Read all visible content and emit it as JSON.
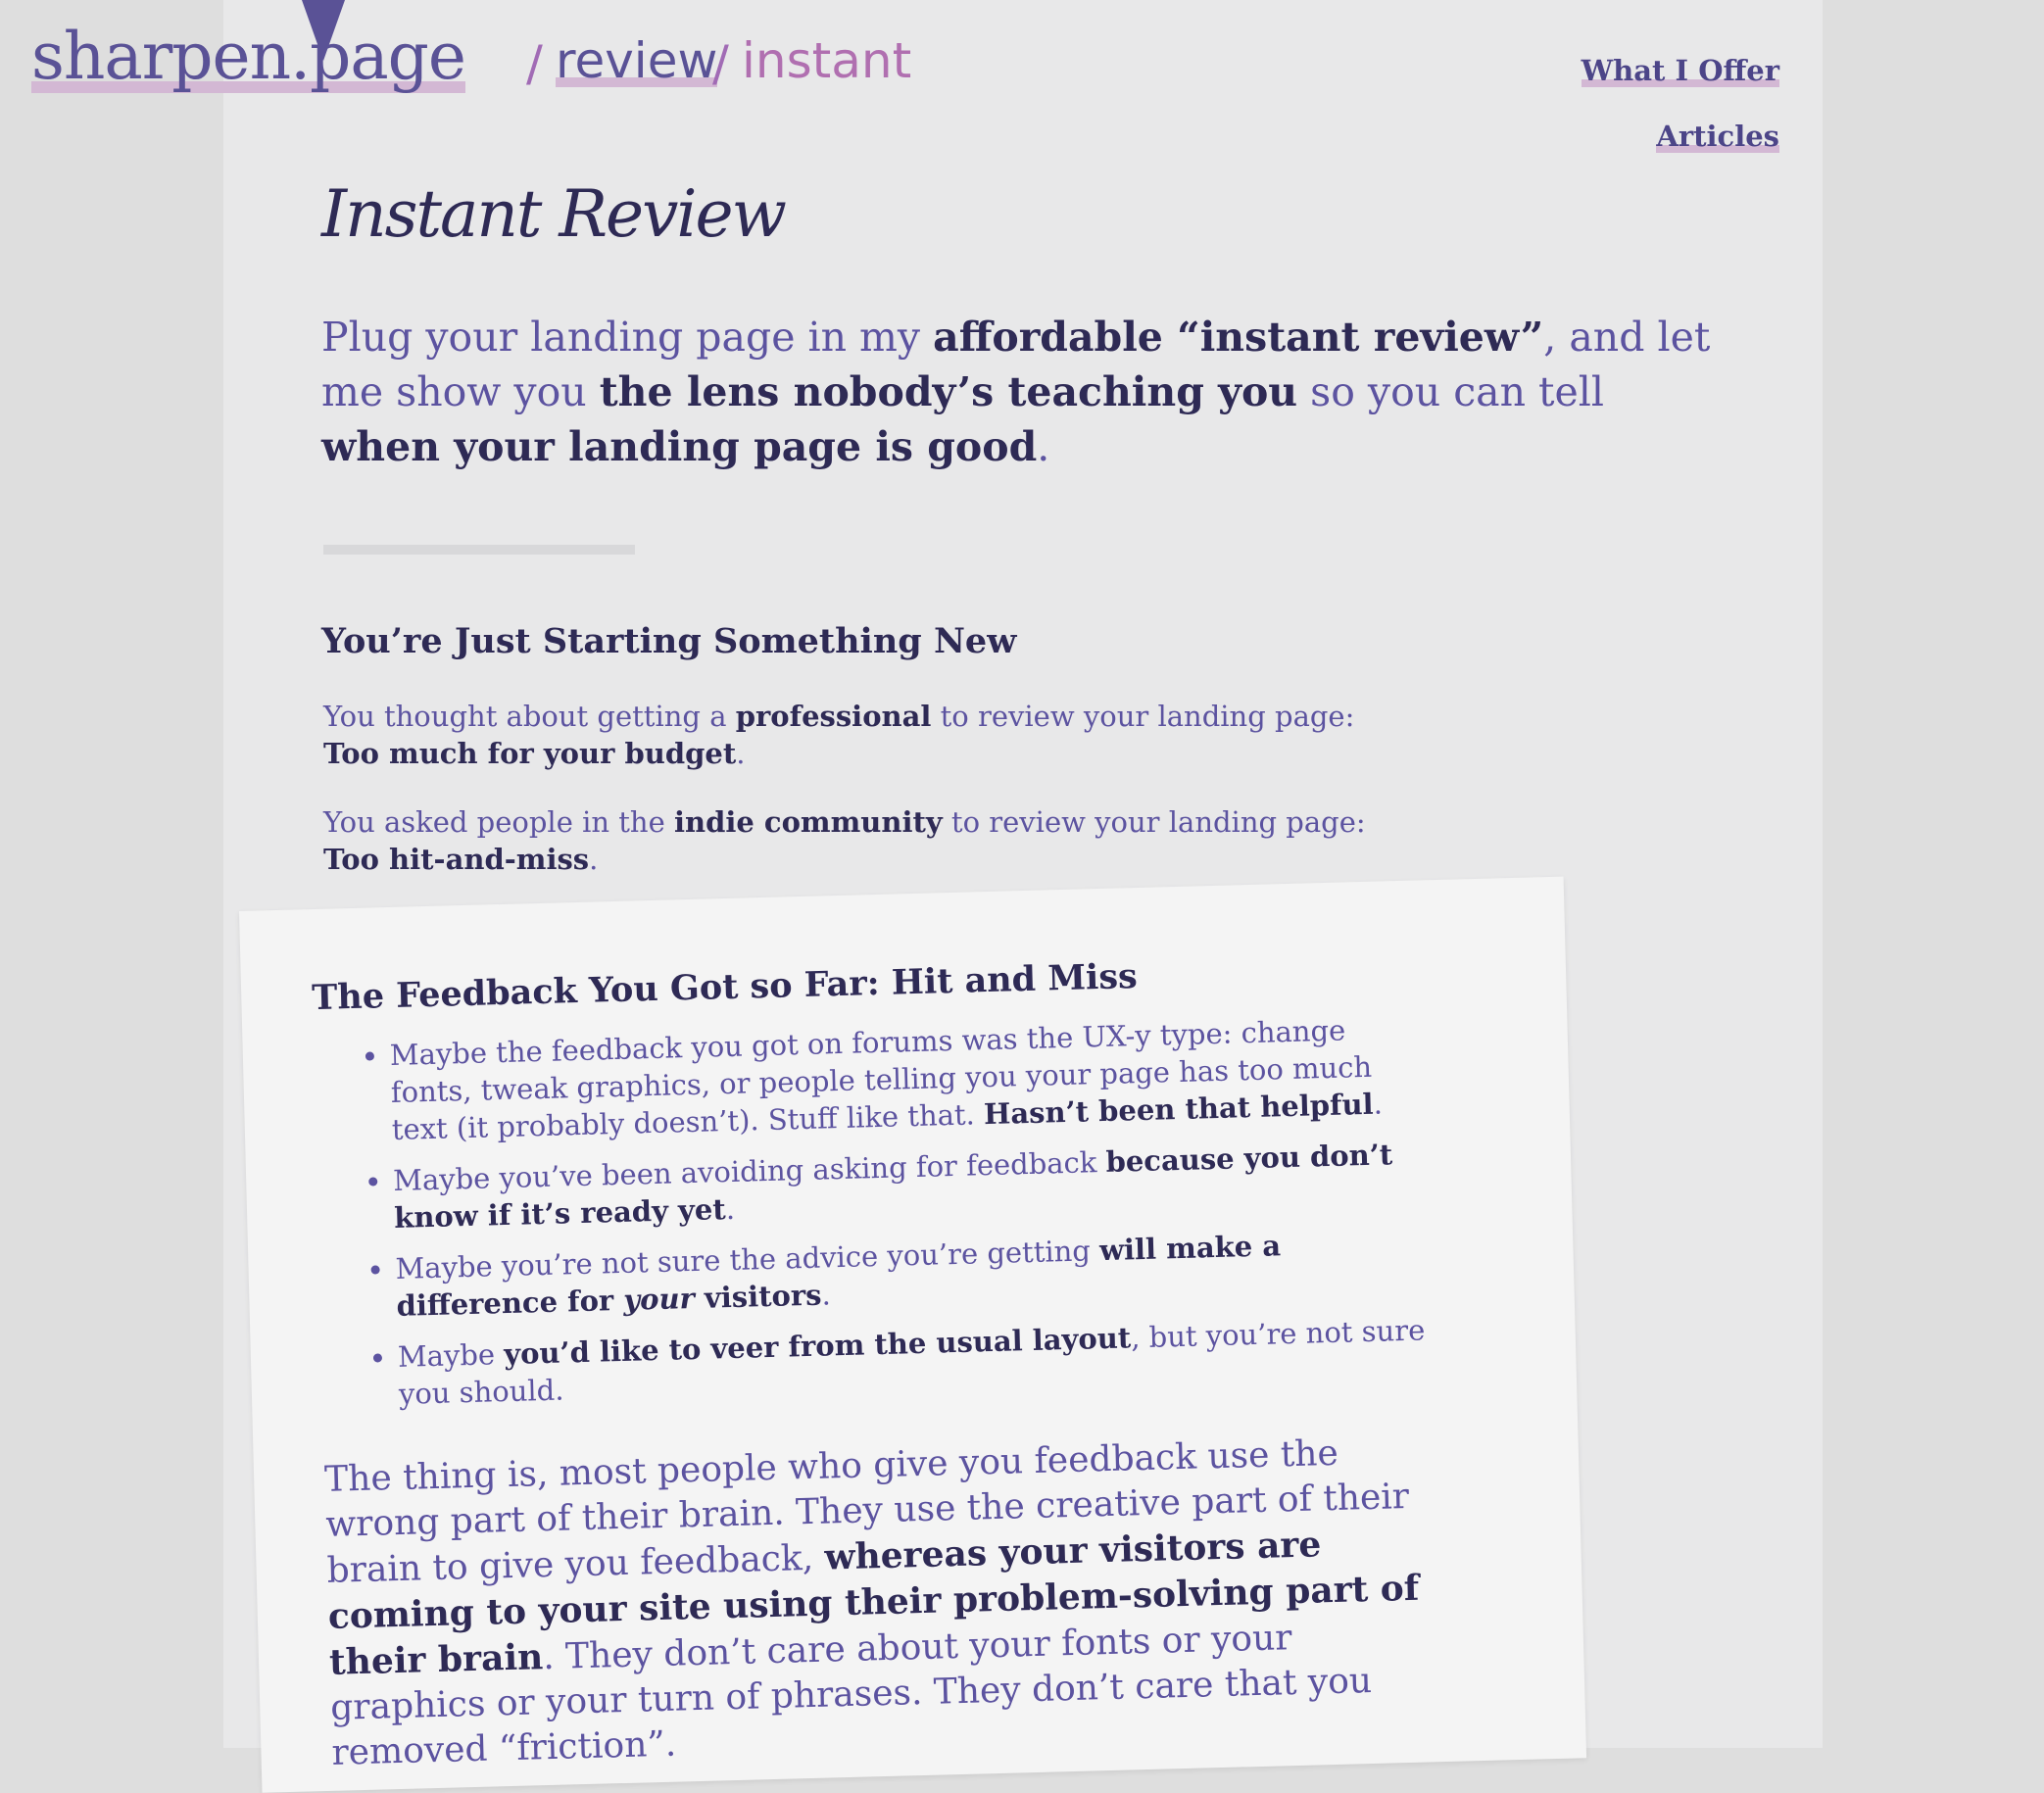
{
  "header": {
    "logo": "sharpen.page",
    "breadcrumb": {
      "sep": "/",
      "review": "review",
      "instant": "instant"
    },
    "nav": [
      "What I Offer",
      "Articles"
    ]
  },
  "main": {
    "title": "Instant Review",
    "lead": {
      "t1": "Plug your landing page in my ",
      "b1": "affordable “instant review”",
      "t2": ", and let me show you ",
      "b2": "the lens nobody’s teaching you",
      "t3": " so you can tell ",
      "b3": "when your landing page is good",
      "t4": "."
    },
    "section_heading": "You’re Just Starting Something New",
    "para1": {
      "t1": "You thought about getting a ",
      "b1": "professional",
      "t2": " to review your landing page:",
      "b2": "Too much for your budget",
      "t3": "."
    },
    "para2": {
      "t1": "You asked people in the ",
      "b1": "indie community",
      "t2": " to review your landing page:",
      "b2": "Too hit-and-miss",
      "t3": "."
    }
  },
  "card": {
    "heading": "The Feedback You Got so Far: Hit and Miss",
    "items": [
      {
        "t1": "Maybe the feedback you got on forums was the UX-y type: change fonts, tweak graphics, or people telling you your page has too much text (it probably doesn’t). Stuff like that. ",
        "b1": "Hasn’t been that helpful",
        "t2": "."
      },
      {
        "t1": "Maybe you’ve been avoiding asking for feedback ",
        "b1": "because you don’t know if it’s ready yet",
        "t2": "."
      },
      {
        "t1": "Maybe you’re not sure the advice you’re getting ",
        "b1": "will make a difference for ",
        "i1": "your",
        "b2": " visitors",
        "t2": "."
      },
      {
        "t1": "Maybe ",
        "b1": "you’d like to veer from the usual layout",
        "t2": ", but you’re not sure you should."
      }
    ],
    "closing": {
      "t1": "The thing is, most people who give you feedback use the wrong part of their brain. They use the creative part of their brain to give you feedback, ",
      "b1": "whereas your visitors are coming to your site using their problem-solving part of their brain",
      "t2": ". They don’t care about your fonts or your graphics or your turn of phrases. They don’t care that you removed “friction”."
    }
  }
}
